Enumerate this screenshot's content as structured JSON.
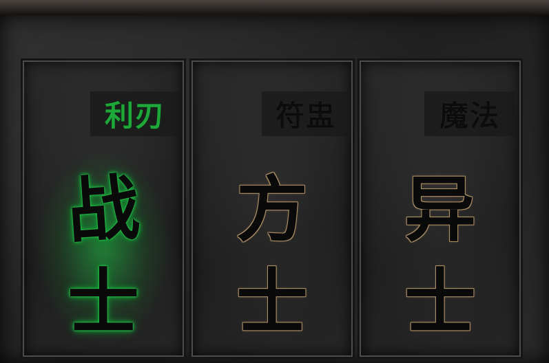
{
  "classes": [
    {
      "tag": "利刃",
      "name_top": "战",
      "name_bottom": "士",
      "selected": true
    },
    {
      "tag": "符盅",
      "name_top": "方",
      "name_bottom": "士",
      "selected": false
    },
    {
      "tag": "魔法",
      "name_top": "异",
      "name_bottom": "士",
      "selected": false
    }
  ],
  "colors": {
    "selected_accent": "#1fa83a",
    "unselected_outline": "#a98d64",
    "background": "#1c1c1c"
  }
}
